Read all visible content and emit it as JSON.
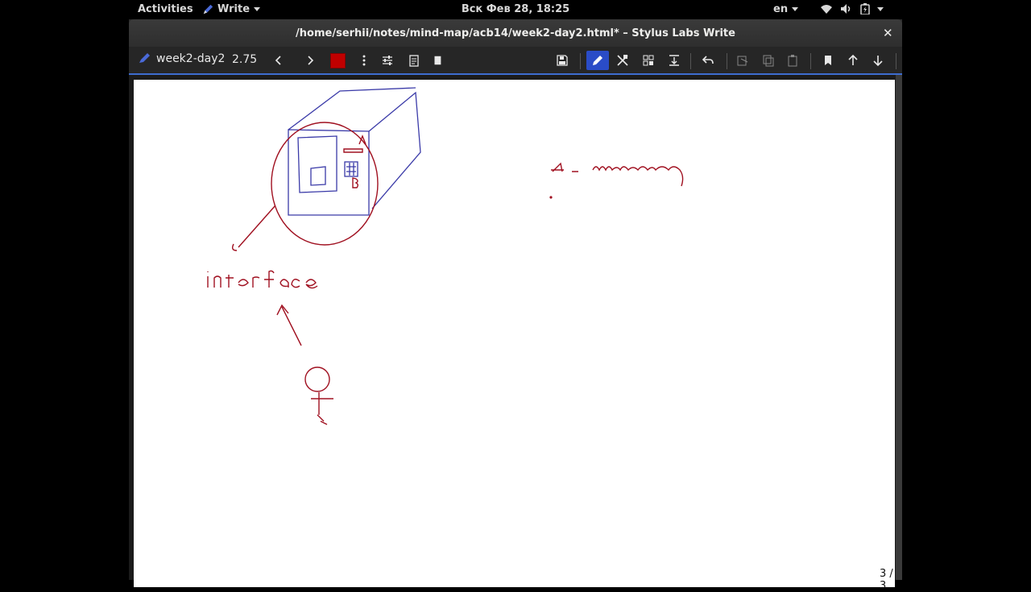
{
  "topbar": {
    "activities": "Activities",
    "app_name": "Write",
    "clock": "Вск Фев 28, 18:25",
    "language": "en"
  },
  "window": {
    "title": "/home/serhii/notes/mind-map/acb14/week2-day2.html* – Stylus Labs Write"
  },
  "toolbar": {
    "doc_name": "week2-day2",
    "zoom": "2.75",
    "pen_color": "#c00000"
  },
  "status": {
    "page_indicator": "3 / 3"
  },
  "accent": "#3d6ccf"
}
